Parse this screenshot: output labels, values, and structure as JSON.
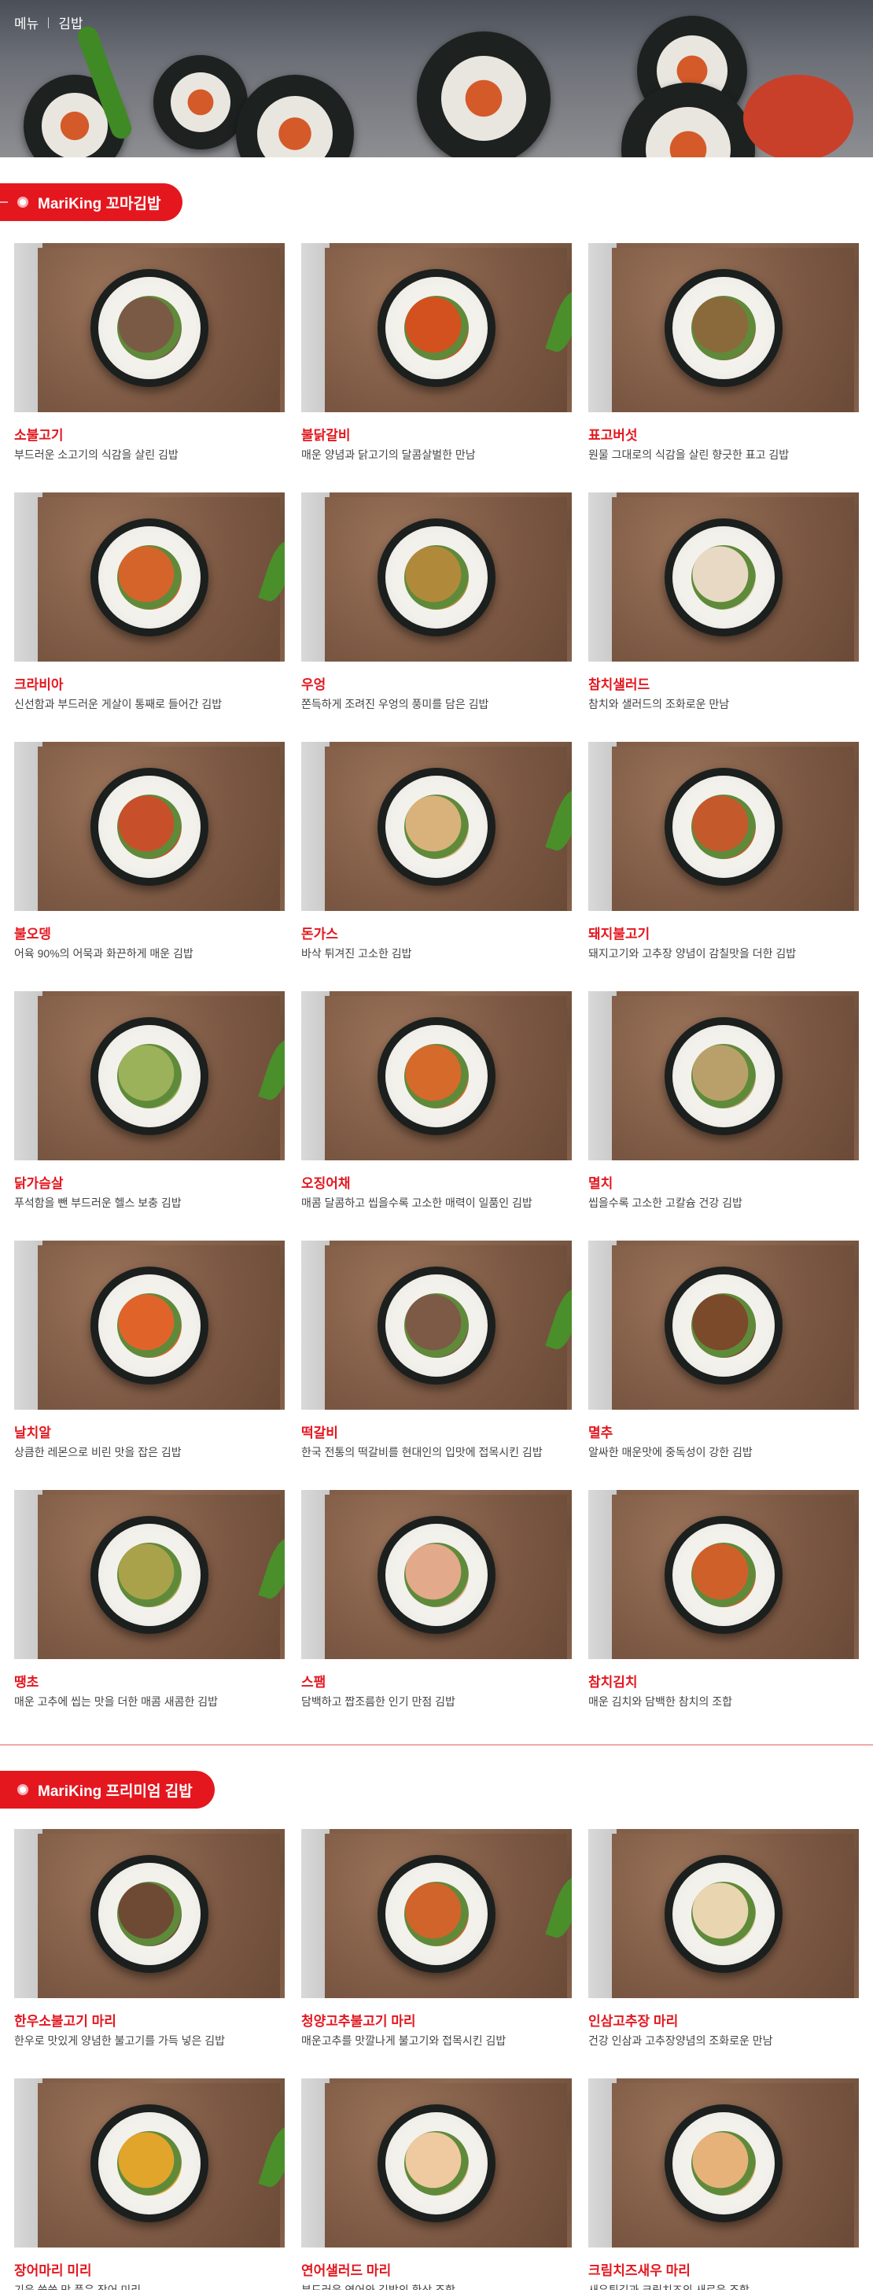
{
  "breadcrumb": {
    "home": "메뉴",
    "current": "김밥"
  },
  "sections": [
    {
      "brand": "MariKing",
      "title": "꼬마김밥",
      "items": [
        {
          "name": "소불고기",
          "desc": "부드러운 소고기의 식감을 살린 김밥",
          "filling": "#7a5a45"
        },
        {
          "name": "불닭갈비",
          "desc": "매운 양념과 닭고기의 달콤살벌한 만남",
          "filling": "#d3511f"
        },
        {
          "name": "표고버섯",
          "desc": "원물 그대로의 식감을 살린 향긋한 표고 김밥",
          "filling": "#8a6a3a"
        },
        {
          "name": "크라비아",
          "desc": "신선함과 부드러운 게살이 통째로 들어간 김밥",
          "filling": "#d5642a"
        },
        {
          "name": "우엉",
          "desc": "쫀득하게 조려진 우엉의 풍미를 담은 김밥",
          "filling": "#b08a3a"
        },
        {
          "name": "참치샐러드",
          "desc": "참치와 샐러드의 조화로운 만남",
          "filling": "#e8d9c4"
        },
        {
          "name": "불오뎅",
          "desc": "어육 90%의 어묵과 화끈하게 매운 김밥",
          "filling": "#c7502a"
        },
        {
          "name": "돈가스",
          "desc": "바삭 튀겨진 고소한 김밥",
          "filling": "#d8b27a"
        },
        {
          "name": "돼지불고기",
          "desc": "돼지고기와 고추장 양념이 감칠맛을 더한 김밥",
          "filling": "#c45a2c"
        },
        {
          "name": "닭가슴살",
          "desc": "푸석함을 뺀 부드러운 헬스 보충 김밥",
          "filling": "#9bb25a"
        },
        {
          "name": "오징어채",
          "desc": "매콤 달콤하고 씹을수록 고소한 매력이 일품인 김밥",
          "filling": "#d56a2a"
        },
        {
          "name": "멸치",
          "desc": "씹을수록 고소한 고칼슘 건강 김밥",
          "filling": "#b9a06a"
        },
        {
          "name": "날치알",
          "desc": "상큼한 레몬으로 비린 맛을 잡은 김밥",
          "filling": "#e0642a"
        },
        {
          "name": "떡갈비",
          "desc": "한국 전통의 떡갈비를 현대인의 입맛에 접목시킨 김밥",
          "filling": "#7d5a45"
        },
        {
          "name": "멸추",
          "desc": "알싸한 매운맛에 중독성이 강한 김밥",
          "filling": "#7a4a2a"
        },
        {
          "name": "땡초",
          "desc": "매운 고추에 씹는 맛을 더한 매콤 새콤한 김밥",
          "filling": "#a9a24a"
        },
        {
          "name": "스팸",
          "desc": "담백하고 짭조름한 인기 만점 김밥",
          "filling": "#e2a98a"
        },
        {
          "name": "참치김치",
          "desc": "매운 김치와 담백한 참치의 조합",
          "filling": "#d0602a"
        }
      ]
    },
    {
      "brand": "MariKing",
      "title": "프리미엄 김밥",
      "items": [
        {
          "name": "한우소불고기 마리",
          "desc": "한우로 맛있게 양념한 불고기를 가득 넣은 김밥",
          "filling": "#6e4a35"
        },
        {
          "name": "청양고추불고기 마리",
          "desc": "매운고추를 맛깔나게 불고기와 접목시킨 김밥",
          "filling": "#d0642a"
        },
        {
          "name": "인삼고추장 마리",
          "desc": "건강 인삼과 고추장양념의 조화로운 만남",
          "filling": "#e9d6b0"
        },
        {
          "name": "장어마리 미리",
          "desc": "기운 쑥쑥 맛 품은 장어 미리",
          "filling": "#e0a52a"
        },
        {
          "name": "연어샐러드 마리",
          "desc": "부드러운 연어와 김밥의 환상 조합",
          "filling": "#efc9a0"
        },
        {
          "name": "크림치즈새우 마리",
          "desc": "새우튀김과 크림치즈의 새로운 조합",
          "filling": "#e6b27a"
        }
      ]
    }
  ],
  "colors": {
    "accent": "#e4171f",
    "divider": "#f2a9ac"
  },
  "icons": {
    "leaf": "herb-garnish-icon"
  }
}
